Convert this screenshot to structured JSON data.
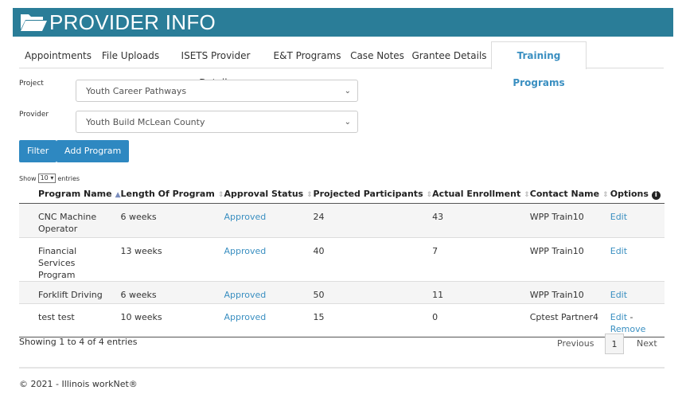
{
  "header": {
    "title": "PROVIDER INFO"
  },
  "tabs": [
    {
      "label": "Appointments"
    },
    {
      "label": "File Uploads"
    },
    {
      "label": "ISETS Provider Details"
    },
    {
      "label": "E&T Programs"
    },
    {
      "label": "Case Notes"
    },
    {
      "label": "Grantee Details"
    },
    {
      "label": "Training Programs"
    }
  ],
  "filters": {
    "project_label": "Project",
    "project_value": "Youth Career Pathways",
    "provider_label": "Provider",
    "provider_value": "Youth Build McLean County"
  },
  "buttons": {
    "filter": "Filter",
    "add_program": "Add Program"
  },
  "length_control": {
    "show": "Show",
    "value": "10",
    "entries": "entries"
  },
  "table": {
    "columns": [
      "Program Name",
      "Length Of Program",
      "Approval Status",
      "Projected Participants",
      "Actual Enrollment",
      "Contact Name",
      "Options"
    ],
    "rows": [
      {
        "name": "CNC Machine Operator",
        "length": "6 weeks",
        "status": "Approved",
        "projected": "24",
        "actual": "43",
        "contact": "WPP Train10",
        "edit": "Edit"
      },
      {
        "name": "Financial Services Program",
        "length": "13 weeks",
        "status": "Approved",
        "projected": "40",
        "actual": "7",
        "contact": "WPP Train10",
        "edit": "Edit"
      },
      {
        "name": "Forklift Driving",
        "length": "6 weeks",
        "status": "Approved",
        "projected": "50",
        "actual": "11",
        "contact": "WPP Train10",
        "edit": "Edit"
      },
      {
        "name": "test test",
        "length": "10 weeks",
        "status": "Approved",
        "projected": "15",
        "actual": "0",
        "contact": "Cptest Partner4",
        "edit": "Edit",
        "sep": " -",
        "remove": "Remove"
      }
    ]
  },
  "info": "Showing 1 to 4 of 4 entries",
  "pagination": {
    "previous": "Previous",
    "page": "1",
    "next": "Next"
  },
  "footer": "© 2021 - Illinois workNet®"
}
